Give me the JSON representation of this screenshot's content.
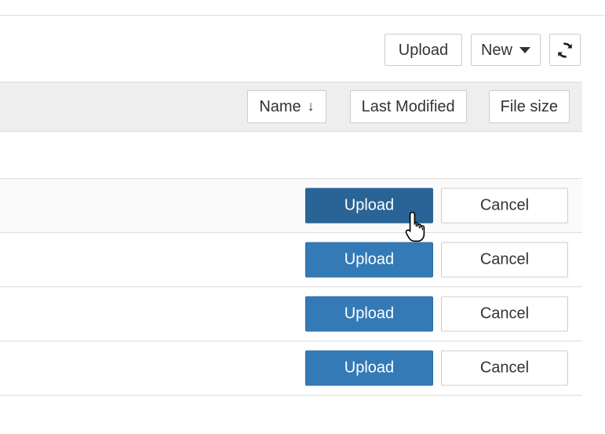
{
  "toolbar": {
    "upload_label": "Upload",
    "new_label": "New",
    "new_caret_icon": "caret-down-icon",
    "refresh_icon": "refresh-icon",
    "refresh_label": ""
  },
  "list_header": {
    "sorters": [
      {
        "label": "Name",
        "arrow": "↓",
        "name": "sort-name"
      },
      {
        "label": "Last Modified",
        "arrow": "",
        "name": "sort-last-modified"
      },
      {
        "label": "File size",
        "arrow": "",
        "name": "sort-file-size"
      }
    ]
  },
  "rows": [
    {
      "type": "plain",
      "upload_label": "",
      "cancel_label": "",
      "state": ""
    },
    {
      "type": "upload",
      "upload_label": "Upload",
      "cancel_label": "Cancel",
      "state": "active"
    },
    {
      "type": "upload",
      "upload_label": "Upload",
      "cancel_label": "Cancel",
      "state": ""
    },
    {
      "type": "upload",
      "upload_label": "Upload",
      "cancel_label": "Cancel",
      "state": ""
    },
    {
      "type": "upload",
      "upload_label": "Upload",
      "cancel_label": "Cancel",
      "state": ""
    }
  ],
  "colors": {
    "primary": "#337ab7",
    "primary_active": "#2a6496",
    "border": "#cccccc",
    "row_border": "#dddddd",
    "header_bg": "#eeeeee",
    "row_hover_bg": "#fafafa"
  },
  "cursor": {
    "icon": "pointer-hand-cursor"
  }
}
